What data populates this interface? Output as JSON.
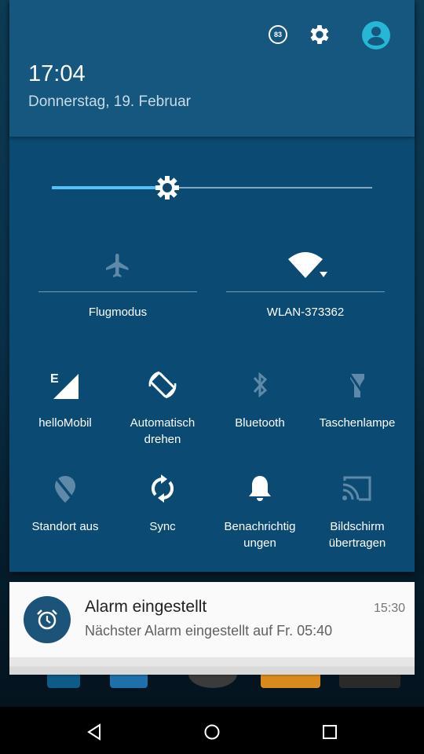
{
  "header": {
    "time": "17:04",
    "date": "Donnerstag, 19. Februar",
    "battery_badge": "83",
    "icons": [
      "battery-badge-icon",
      "settings-gear-icon",
      "user-avatar-icon"
    ]
  },
  "brightness": {
    "level_fraction": 0.36
  },
  "big_tiles": [
    {
      "label": "Flugmodus",
      "icon": "airplane-off-icon"
    },
    {
      "label": "WLAN-373362",
      "icon": "wifi-icon"
    }
  ],
  "tiles_row1": [
    {
      "label": "helloMobil",
      "label2": "",
      "icon": "cell-signal-icon",
      "network_type": "E"
    },
    {
      "label": "Automatisch",
      "label2": "drehen",
      "icon": "auto-rotate-icon"
    },
    {
      "label": "Bluetooth",
      "label2": "",
      "icon": "bluetooth-off-icon"
    },
    {
      "label": "Taschenlampe",
      "label2": "",
      "icon": "flashlight-off-icon"
    }
  ],
  "tiles_row2": [
    {
      "label": "Standort aus",
      "label2": "",
      "icon": "location-off-icon"
    },
    {
      "label": "Sync",
      "label2": "",
      "icon": "sync-icon"
    },
    {
      "label": "Benachrichtig",
      "label2": "ungen",
      "icon": "bell-icon"
    },
    {
      "label": "Bildschirm",
      "label2": "übertragen",
      "icon": "cast-icon"
    }
  ],
  "notification": {
    "title": "Alarm eingestellt",
    "time": "15:30",
    "text": "Nächster Alarm eingestellt auf Fr. 05:40",
    "icon": "alarm-clock-icon"
  },
  "navbar": {
    "icons": [
      "back-icon",
      "home-icon",
      "recents-icon"
    ]
  },
  "colors": {
    "accent": "#4fc3f7",
    "panel": "#0b4a72",
    "header": "#15577f",
    "avatar": "#26b6d6"
  }
}
